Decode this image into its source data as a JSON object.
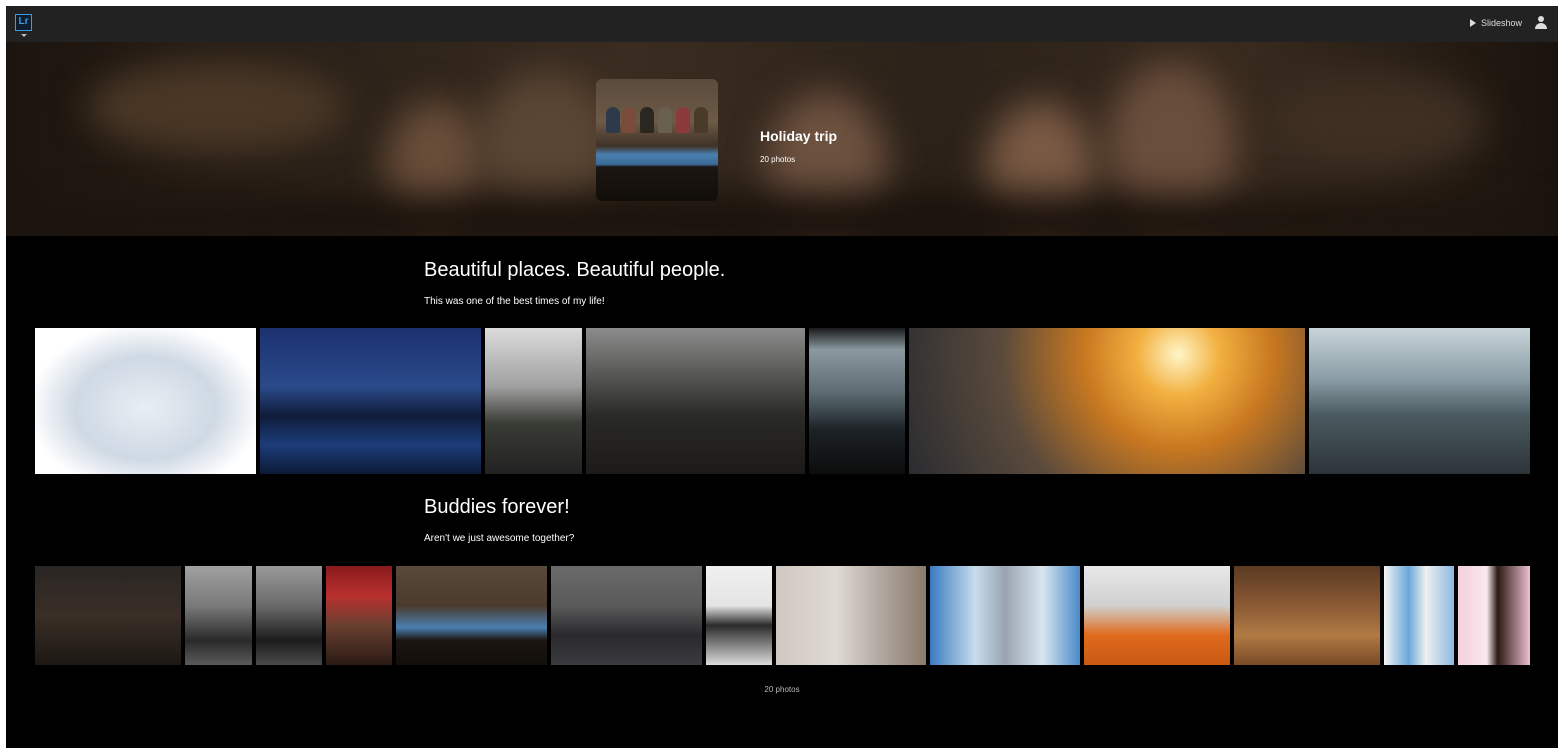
{
  "app": {
    "logo_text": "Lr"
  },
  "topbar": {
    "slideshow_label": "Slideshow"
  },
  "album": {
    "title": "Holiday trip",
    "count": "20 photos"
  },
  "sections": [
    {
      "title": "Beautiful places. Beautiful people.",
      "subtitle": "This was one of the best times of my life!"
    },
    {
      "title": "Buddies forever!",
      "subtitle": "Aren't we just awesome together?"
    }
  ],
  "footer": {
    "count": "20 photos"
  },
  "icons": [
    "lr-logo-icon",
    "chevron-down-icon",
    "play-icon",
    "user-icon"
  ],
  "colors": {
    "background": "#000000",
    "topbar": "#222222",
    "accent": "#3d9be0"
  }
}
